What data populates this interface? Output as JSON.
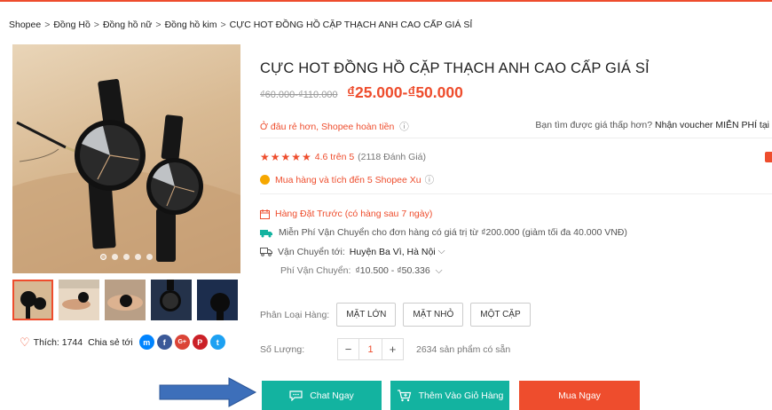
{
  "breadcrumb": {
    "items": [
      "Shopee",
      "Đồng Hồ",
      "Đồng hồ nữ",
      "Đồng hồ kim"
    ],
    "current": "CỰC HOT ĐỒNG HỒ CẶP THẠCH ANH CAO CẤP GIÁ SỈ",
    "separator": ">"
  },
  "product": {
    "title": "CỰC HOT ĐỒNG HỒ CẶP THẠCH ANH CAO CẤP GIÁ SỈ",
    "old_price": "₫60.000-₫110.000",
    "price": "₫25.000-₫50.000",
    "guarantee": "Ở đâu rẻ hơn, Shopee hoàn tiền",
    "voucher_question": "Bạn tìm được giá thấp hơn?",
    "voucher_action": "Nhận voucher MIỄN PHÍ tại",
    "stars": "★★★★★",
    "rating_score": "4.6 trên 5",
    "rating_count": "(2118 Đánh Giá)",
    "coins": "Mua hàng và tích đến 5 Shopee Xu",
    "preorder": "Hàng Đặt Trước (có hàng sau 7 ngày)",
    "free_shipping": "Miễn Phí Vận Chuyển cho đơn hàng có giá trị từ ₫200.000 (giảm tối đa 40.000 VNĐ)",
    "ship_to_label": "Vận Chuyển tới:",
    "ship_to_location": "Huyện Ba Vì, Hà Nội",
    "ship_fee_label": "Phí Vận Chuyển:",
    "ship_fee_value": "₫10.500 - ₫50.336"
  },
  "variation": {
    "label": "Phân Loại Hàng:",
    "options": [
      "MẶT LỚN",
      "MẶT NHỎ",
      "MỘT CẶP"
    ]
  },
  "quantity": {
    "label": "Số Lượng:",
    "value": "1",
    "minus": "−",
    "plus": "+",
    "stock": "2634 sản phẩm có sẵn"
  },
  "gallery": {
    "thumb_count": 5,
    "active_index": 0
  },
  "social": {
    "like": "Thích: 1744",
    "share": "Chia sẻ tới",
    "icons": [
      {
        "name": "messenger-icon",
        "glyph": "m",
        "color": "#0084ff"
      },
      {
        "name": "facebook-icon",
        "glyph": "f",
        "color": "#3b5998"
      },
      {
        "name": "google-plus-icon",
        "glyph": "G+",
        "color": "#db4437"
      },
      {
        "name": "pinterest-icon",
        "glyph": "P",
        "color": "#cb2027"
      },
      {
        "name": "twitter-icon",
        "glyph": "t",
        "color": "#1da1f2"
      }
    ]
  },
  "actions": {
    "chat": "Chat Ngay",
    "add_to_cart": "Thêm Vào Giỏ Hàng",
    "buy_now": "Mua Ngay"
  },
  "colors": {
    "accent": "#ee4d2d",
    "teal": "#13b3a0",
    "arrow": "#3d6fba"
  }
}
